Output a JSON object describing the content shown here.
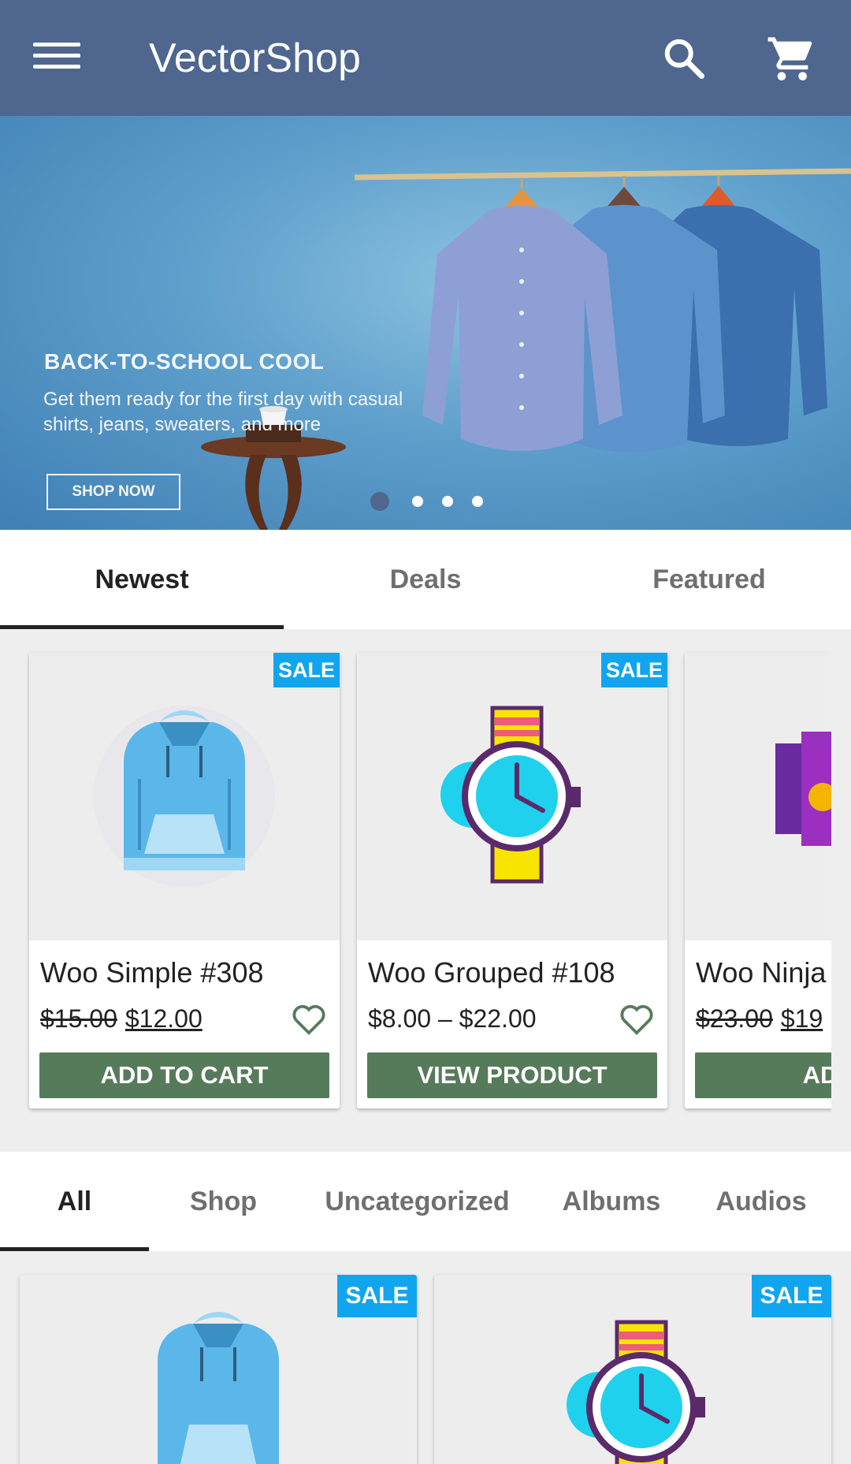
{
  "appbar": {
    "title": "VectorShop",
    "menu_icon": "menu-icon",
    "search_icon": "search-icon",
    "cart_icon": "cart-icon",
    "color": "#4f668f"
  },
  "banner": {
    "headline": "BACK-TO-SCHOOL COOL",
    "subtitle": "Get them ready for the first day with casual shirts, jeans, sweaters, and more",
    "cta": "SHOP NOW",
    "slide_count": 4,
    "active_slide": 1
  },
  "section_tabs": [
    {
      "label": "Newest",
      "active": true
    },
    {
      "label": "Deals",
      "active": false
    },
    {
      "label": "Featured",
      "active": false
    }
  ],
  "products": [
    {
      "name": "Woo Simple #308",
      "old_price": "$15.00",
      "price": "$12.00",
      "badge": "SALE",
      "button": "ADD TO CART",
      "image": "hoodie"
    },
    {
      "name": "Woo Grouped #108",
      "price_range": "$8.00 – $22.00",
      "badge": "SALE",
      "button": "VIEW PRODUCT",
      "image": "watch"
    },
    {
      "name": "Woo Ninja",
      "old_price": "$23.00",
      "price": "$19",
      "button": "ADD T",
      "image": "album"
    }
  ],
  "category_tabs": [
    {
      "label": "All",
      "active": true
    },
    {
      "label": "Shop",
      "active": false
    },
    {
      "label": "Uncategorized",
      "active": false
    },
    {
      "label": "Albums",
      "active": false
    },
    {
      "label": "Audios",
      "active": false
    }
  ],
  "grid": [
    {
      "badge": "SALE",
      "image": "hoodie"
    },
    {
      "badge": "SALE",
      "image": "watch"
    }
  ],
  "colors": {
    "sale_badge": "#12a5ef",
    "button": "#567b5b",
    "heart": "#567b5b"
  }
}
